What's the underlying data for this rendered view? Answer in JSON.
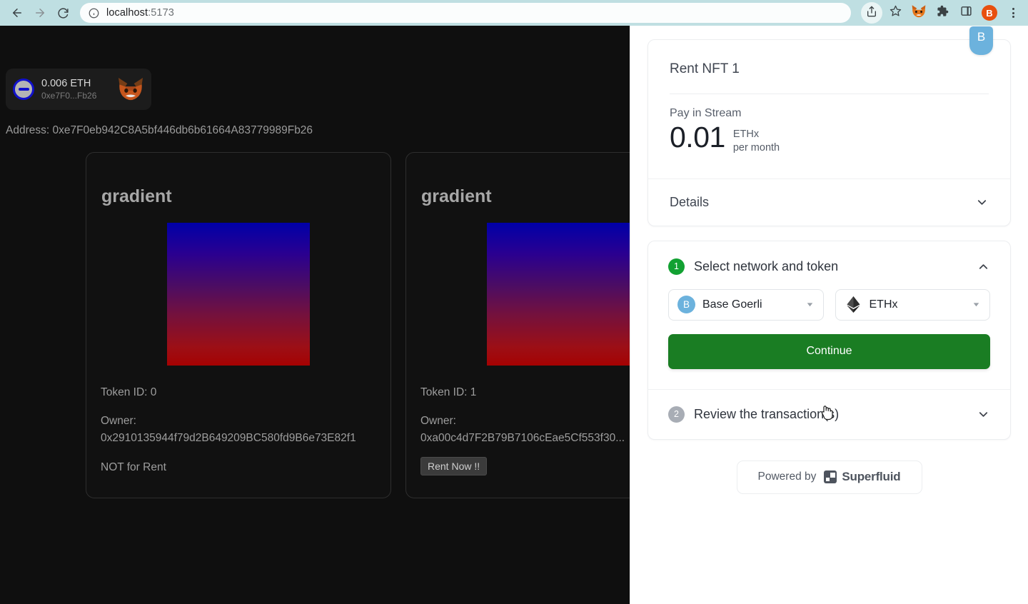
{
  "browser": {
    "back_icon": "back-arrow-icon",
    "forward_icon": "forward-arrow-icon",
    "reload_icon": "reload-icon",
    "info_icon": "site-info-icon",
    "url_host": "localhost",
    "url_port": ":5173",
    "url_full": "localhost:5173",
    "icons": [
      "share-icon",
      "bookmark-star-icon",
      "metamask-extension-icon",
      "extensions-puzzle-icon",
      "side-panel-icon"
    ],
    "profile_initial": "B",
    "menu_icon": "three-dot-menu-icon"
  },
  "wallet": {
    "network_icon": "goerli-network-icon",
    "balance": "0.006 ETH",
    "address_short": "0xe7F0...Fb26",
    "provider_icon": "metamask-fox-icon"
  },
  "page": {
    "address_line": "Address: 0xe7F0eb942C8A5bf446db6b61664A83779989Fb26"
  },
  "nfts": [
    {
      "title": "gradient",
      "token_id_label": "Token ID: 0",
      "owner_label": "Owner:",
      "owner_address": "0x2910135944f79d2B649209BC580fd9B6e73E82f1",
      "status": "NOT for Rent",
      "rent_label": null
    },
    {
      "title": "gradient",
      "token_id_label": "Token ID: 1",
      "owner_label": "Owner:",
      "owner_address": "0xa00c4d7F2B79B7106cEae5Cf553f30...",
      "status": null,
      "rent_label": "Rent Now !!"
    }
  ],
  "widget": {
    "badge_initial": "B",
    "title": "Rent NFT 1",
    "pay_label": "Pay in Stream",
    "amount": "0.01",
    "token": "ETHx",
    "period": "per month",
    "details_label": "Details",
    "details_chevron": "chevron-down-icon",
    "steps": [
      {
        "number": "1",
        "label": "Select network and token",
        "state": "done",
        "chevron": "chevron-up-icon",
        "network": {
          "icon": "base-goerli-icon",
          "label": "Base Goerli",
          "caret": "dropdown-caret-icon"
        },
        "token": {
          "icon": "ethereum-diamond-icon",
          "label": "ETHx",
          "caret": "dropdown-caret-icon"
        },
        "continue_label": "Continue"
      },
      {
        "number": "2",
        "label": "Review the transaction(s)",
        "state": "pending",
        "chevron": "chevron-down-icon"
      }
    ],
    "powered_by_label": "Powered by",
    "brand_name": "Superfluid"
  },
  "colors": {
    "browser_bar": "#bfdfe2",
    "page_bg": "#0f0f0f",
    "panel_bg": "#ffffff",
    "accent_green": "#1a7d23",
    "step_done": "#12a132",
    "step_pending": "#a8adb5",
    "badge_blue": "#6cb2dd",
    "profile_orange": "#e8500f"
  }
}
